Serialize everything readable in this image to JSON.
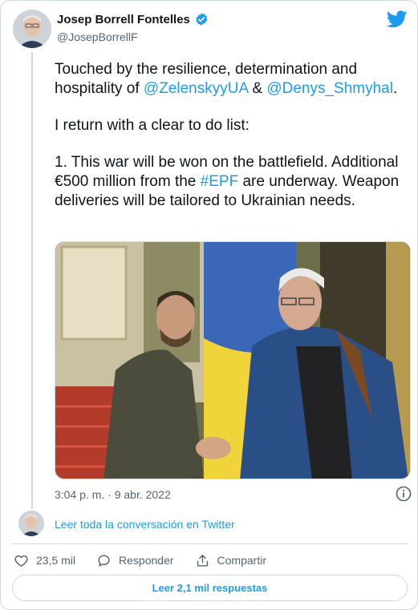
{
  "author": {
    "display_name": "Josep Borrell Fontelles",
    "handle": "@JosepBorrellF",
    "verified": true
  },
  "tweet": {
    "line1_pre": "Touched by the resilience, determination and hospitality of ",
    "mention1": "@ZelenskyyUA",
    "line1_mid": " & ",
    "mention2": "@Denys_Shmyhal",
    "line1_post": ".",
    "para2": "I return with a clear to do list:",
    "para3_pre": "1. This war will be won on the battlefield. Additional €500 million from the ",
    "hashtag": "#EPF",
    "para3_post": " are underway. Weapon deliveries will be tailored to Ukrainian needs."
  },
  "timestamp": "3:04 p. m. · 9 abr. 2022",
  "conversation_link": "Leer toda la conversación en Twitter",
  "actions": {
    "likes": "23,5 mil",
    "reply_label": "Responder",
    "share_label": "Compartir"
  },
  "read_replies_label": "Leer 2,1 mil respuestas",
  "colors": {
    "link": "#1d9bf0",
    "text": "#0f1419",
    "muted": "#536471",
    "border": "#cfd9de"
  },
  "icons": [
    "verified-icon",
    "twitter-logo-icon",
    "info-icon",
    "heart-icon",
    "reply-icon",
    "share-icon"
  ]
}
